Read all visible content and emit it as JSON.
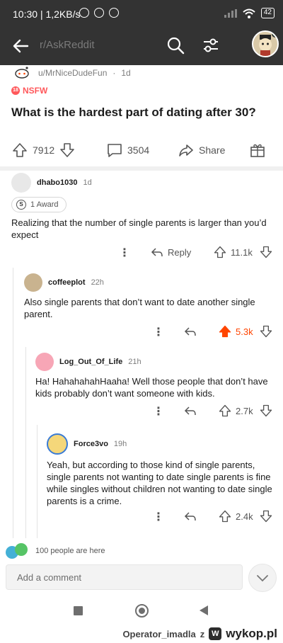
{
  "status_bar": {
    "time": "10:30",
    "speed": "1,2KB/s",
    "battery": "42"
  },
  "header": {
    "subreddit": "r/AskReddit"
  },
  "post": {
    "author": "u/MrNiceDudeFun",
    "age": "1d",
    "flair": "NSFW",
    "title": "What is the hardest part of dating after 30?",
    "upvotes": "7912",
    "comments": "3504",
    "share_label": "Share"
  },
  "comments": [
    {
      "user": "dhabo1030",
      "time": "1d",
      "award": "1 Award",
      "body": "Realizing that the number of single parents is larger than you’d expect",
      "reply_label": "Reply",
      "score": "11.1k",
      "upvoted": false
    },
    {
      "user": "coffeeplot",
      "time": "22h",
      "body": "Also single parents that don’t want to date another single parent.",
      "score": "5.3k",
      "upvoted": true
    },
    {
      "user": "Log_Out_Of_Life",
      "time": "21h",
      "body": "Ha! HahahahahHaaha! Well those people that don’t have kids probably don’t want someone with kids.",
      "score": "2.7k",
      "upvoted": false
    },
    {
      "user": "Force3vo",
      "time": "19h",
      "body": "Yeah, but according to those kind of single parents, single parents not wanting to date single parents is fine while singles without children not wanting to date single parents is a crime.",
      "score": "2.4k",
      "upvoted": false
    }
  ],
  "presence": {
    "text": "100 people are here"
  },
  "comment_input": {
    "placeholder": "Add a comment"
  },
  "watermark": {
    "user": "Operator_imadla",
    "z": "z",
    "brand": "wykop.pl"
  },
  "colors": {
    "upvote_active": "#ff4500",
    "header_bg": "#333333",
    "nsfw": "#ff585b"
  }
}
